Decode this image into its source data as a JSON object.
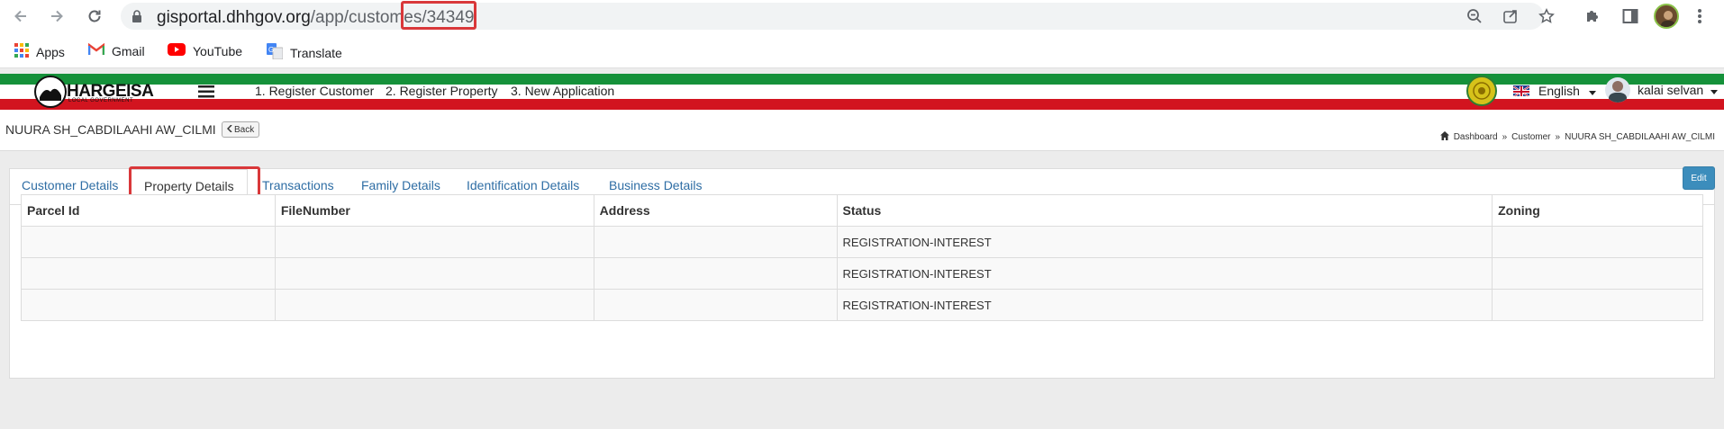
{
  "browser": {
    "url_host": "gisportal.dhhgov.org",
    "url_path": "/app/custome",
    "url_path_highlighted": "s/34349",
    "bookmarks": [
      "Apps",
      "Gmail",
      "YouTube",
      "Translate"
    ]
  },
  "app_header": {
    "logo_text": "HARGEISA",
    "logo_subtext": "LOCAL GOVERNMENT",
    "nav": [
      "1. Register Customer",
      "2. Register Property",
      "3. New Application"
    ],
    "language": "English",
    "user_name": "kalai selvan"
  },
  "page": {
    "title": "NUURA SH_CABDILAAHI AW_CILMI",
    "back_label": "Back",
    "breadcrumb": [
      "Dashboard",
      "Customer",
      "NUURA SH_CABDILAAHI AW_CILMI"
    ]
  },
  "tabs": [
    "Customer Details",
    "Property Details",
    "Transactions",
    "Family Details",
    "Identification Details",
    "Business Details"
  ],
  "active_tab": "Property Details",
  "edit_label": "Edit",
  "table": {
    "headers": [
      "Parcel Id",
      "FileNumber",
      "Address",
      "Status",
      "Zoning"
    ],
    "rows": [
      [
        "",
        "",
        "",
        "REGISTRATION-INTEREST",
        ""
      ],
      [
        "",
        "",
        "",
        "REGISTRATION-INTEREST",
        ""
      ],
      [
        "",
        "",
        "",
        "REGISTRATION-INTEREST",
        ""
      ]
    ]
  },
  "colors": {
    "link": "#2e6da4",
    "stripe_green": "#15913a",
    "stripe_red": "#d2141f",
    "highlight": "#d9383a",
    "edit_button": "#3c8dbc"
  }
}
